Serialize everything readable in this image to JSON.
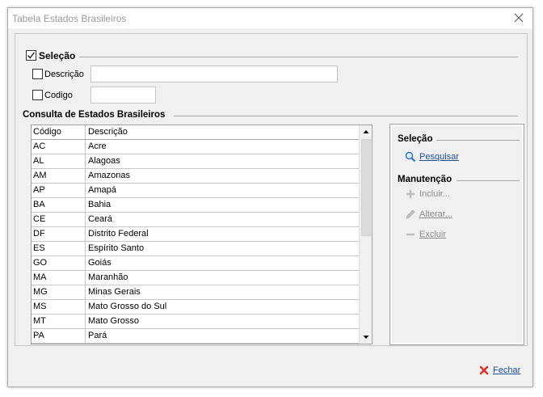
{
  "window": {
    "title": "Tabela Estados Brasileiros"
  },
  "selection": {
    "title": "Seleção",
    "checked": true,
    "descricao_label": "Descrição",
    "descricao_value": "",
    "codigo_label": "Codigo",
    "codigo_value": ""
  },
  "consulta": {
    "title": "Consulta de Estados Brasileiros",
    "columns": [
      "Código",
      "Descrição"
    ],
    "rows": [
      [
        "AC",
        "Acre"
      ],
      [
        "AL",
        "Alagoas"
      ],
      [
        "AM",
        "Amazonas"
      ],
      [
        "AP",
        "Amapá"
      ],
      [
        "BA",
        "Bahia"
      ],
      [
        "CE",
        "Ceará"
      ],
      [
        "DF",
        "Distrito Federal"
      ],
      [
        "ES",
        "Espírito Santo"
      ],
      [
        "GO",
        "Goiás"
      ],
      [
        "MA",
        "Maranhão"
      ],
      [
        "MG",
        "Minas Gerais"
      ],
      [
        "MS",
        "Mato Grosso do Sul"
      ],
      [
        "MT",
        "Mato Grosso"
      ],
      [
        "PA",
        "Pará"
      ]
    ]
  },
  "side": {
    "selecao_title": "Seleção",
    "pesquisar": "Pesquisar",
    "manutencao_title": "Manutenção",
    "incluir": "Incluir...",
    "alterar": "Alterar...",
    "excluir": "Excluir"
  },
  "footer": {
    "fechar": "Fechar"
  },
  "colors": {
    "link": "#1f4e99",
    "disabled": "#8a8a8a",
    "close_red": "#d9342b"
  }
}
